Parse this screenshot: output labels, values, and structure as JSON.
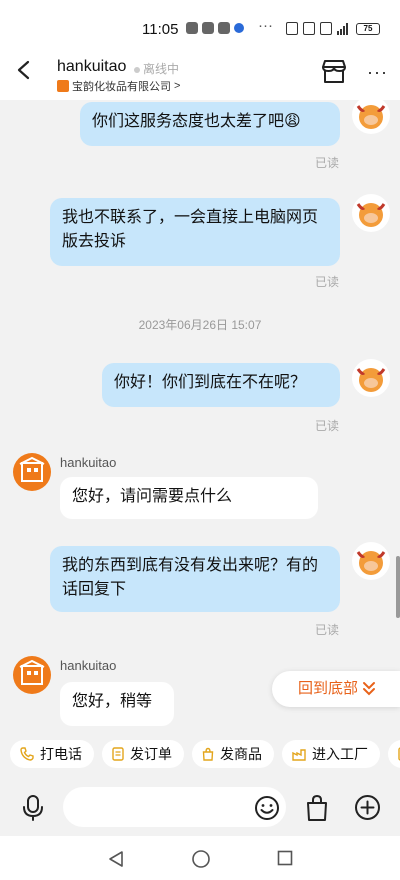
{
  "status_bar": {
    "time": "11:05",
    "more": "···",
    "battery": "75"
  },
  "header": {
    "contact_name": "hankuitao",
    "status": "离线中",
    "company": "宝韵化妆品有限公司",
    "company_chevron": ">"
  },
  "messages": [
    {
      "from": "me",
      "text": "你们这服务态度也太差了吧😩",
      "read": "已读"
    },
    {
      "from": "me",
      "text": "我也不联系了，一会直接上电脑网页版去投诉",
      "read": "已读"
    },
    {
      "type": "timestamp",
      "text": "2023年06月26日 15:07"
    },
    {
      "from": "me",
      "text": "你好！你们到底在不在呢？",
      "read": "已读"
    },
    {
      "from": "them",
      "sender": "hankuitao",
      "text": "您好，请问需要点什么"
    },
    {
      "from": "me",
      "text": "我的东西到底有没有发出来呢？有的话回复下",
      "read": "已读"
    },
    {
      "from": "them",
      "sender": "hankuitao",
      "text": "您好，稍等"
    }
  ],
  "back_to_bottom": {
    "label": "回到底部",
    "chevrons": "≫"
  },
  "quick_actions": [
    {
      "label": "打电话",
      "icon": "phone-icon"
    },
    {
      "label": "发订单",
      "icon": "order-icon"
    },
    {
      "label": "发商品",
      "icon": "product-icon"
    },
    {
      "label": "进入工厂",
      "icon": "factory-icon"
    },
    {
      "label": "",
      "icon": "more-action-icon"
    }
  ],
  "input": {
    "placeholder": ""
  },
  "colors": {
    "accent": "#e8621a",
    "bubble_me": "#c7e6fb",
    "avatar_bg": "#ef7a1a"
  }
}
